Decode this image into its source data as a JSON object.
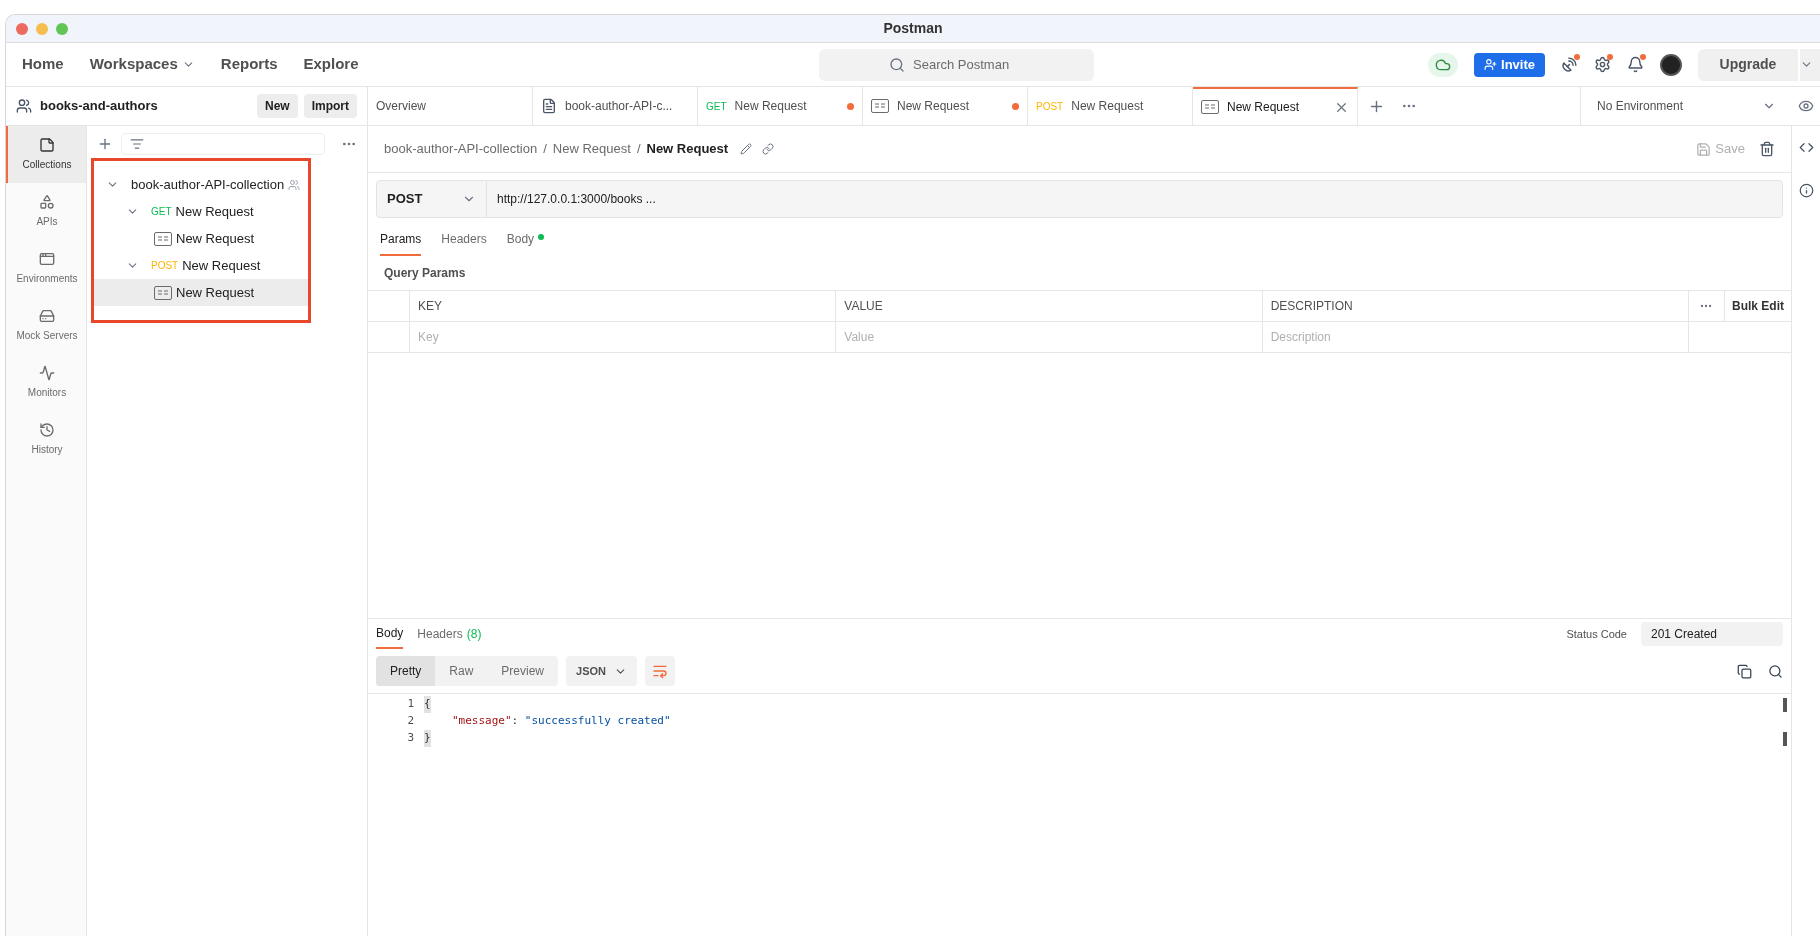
{
  "window": {
    "title": "Postman"
  },
  "nav": {
    "items": [
      {
        "label": "Home",
        "dropdown": false
      },
      {
        "label": "Workspaces",
        "dropdown": true
      },
      {
        "label": "Reports",
        "dropdown": false
      },
      {
        "label": "Explore",
        "dropdown": false
      }
    ],
    "search": {
      "placeholder": "Search Postman"
    },
    "invite": "Invite",
    "upgrade": "Upgrade"
  },
  "workspace": {
    "name": "books-and-authors",
    "buttons": [
      "New",
      "Import"
    ]
  },
  "tabs": [
    {
      "label": "Overview",
      "kind": "overview",
      "selected": false,
      "unsaved": false
    },
    {
      "label": "book-author-API-c...",
      "kind": "collection",
      "selected": false,
      "unsaved": false
    },
    {
      "label": "New Request",
      "kind": "request",
      "method": "GET",
      "selected": false,
      "unsaved": true
    },
    {
      "label": "New Request",
      "kind": "example",
      "selected": false,
      "unsaved": true
    },
    {
      "label": "New Request",
      "kind": "request",
      "method": "POST",
      "selected": false,
      "unsaved": false
    },
    {
      "label": "New Request",
      "kind": "example",
      "selected": true,
      "unsaved": false
    }
  ],
  "environment": "No Environment",
  "side_nav": [
    {
      "label": "Collections",
      "kind": "collections",
      "selected": true
    },
    {
      "label": "APIs",
      "kind": "apis",
      "selected": false
    },
    {
      "label": "Environments",
      "kind": "environments",
      "selected": false
    },
    {
      "label": "Mock Servers",
      "kind": "mocks",
      "selected": false
    },
    {
      "label": "Monitors",
      "kind": "monitors",
      "selected": false
    },
    {
      "label": "History",
      "kind": "history",
      "selected": false
    }
  ],
  "tree": [
    {
      "label": "book-author-API-collection",
      "kind": "collection",
      "expanded": true,
      "selected": false,
      "children": [
        {
          "label": "New Request",
          "kind": "request",
          "method": "GET",
          "expanded": true,
          "selected": false,
          "children": [
            {
              "label": "New Request",
              "kind": "example",
              "selected": false
            }
          ]
        },
        {
          "label": "New Request",
          "kind": "request",
          "method": "POST",
          "expanded": true,
          "selected": false,
          "children": [
            {
              "label": "New Request",
              "kind": "example",
              "selected": true
            }
          ]
        }
      ]
    }
  ],
  "breadcrumb": {
    "separator": "/",
    "items": [
      "book-author-API-collection",
      "New Request",
      "New Request"
    ]
  },
  "save": "Save",
  "request": {
    "method": "POST",
    "url": "http://127.0.0.1:3000/books ..."
  },
  "request_tabs": [
    {
      "label": "Params",
      "selected": true,
      "dot": false
    },
    {
      "label": "Headers",
      "selected": false,
      "dot": false
    },
    {
      "label": "Body",
      "selected": false,
      "dot": true
    }
  ],
  "query_params": {
    "title": "Query Params",
    "columns": [
      "KEY",
      "VALUE",
      "DESCRIPTION"
    ],
    "bulk_edit": "Bulk Edit",
    "placeholders": [
      "Key",
      "Value",
      "Description"
    ]
  },
  "response": {
    "tabs": [
      {
        "label": "Body",
        "selected": true
      },
      {
        "label": "Headers",
        "count": "(8)",
        "selected": false
      }
    ],
    "status_label": "Status Code",
    "status": "201 Created",
    "views": [
      {
        "label": "Pretty",
        "selected": true
      },
      {
        "label": "Raw",
        "selected": false
      },
      {
        "label": "Preview",
        "selected": false
      }
    ],
    "format": "JSON",
    "lines": [
      {
        "number": "1",
        "tokens": [
          {
            "kind": "brace",
            "text": "{"
          }
        ]
      },
      {
        "number": "2",
        "tokens": [
          {
            "kind": "key",
            "text": "\"message\""
          },
          {
            "kind": "punct",
            "text": ": "
          },
          {
            "kind": "string",
            "text": "\"successfully created\""
          }
        ]
      },
      {
        "number": "3",
        "tokens": [
          {
            "kind": "brace",
            "text": "}"
          }
        ]
      }
    ]
  }
}
